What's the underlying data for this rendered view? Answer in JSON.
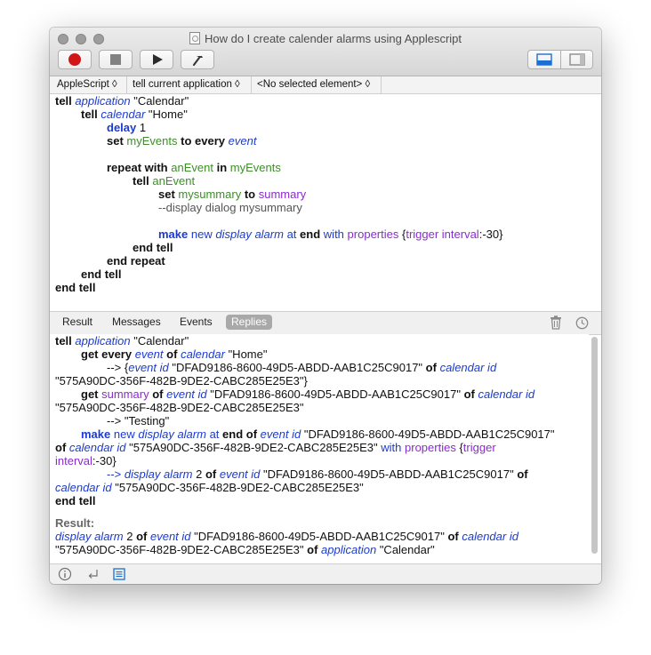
{
  "window": {
    "title": "How do I create calender alarms using Applescript"
  },
  "toolbar": {
    "record_icon": "record-dot",
    "stop_icon": "stop-square",
    "run_icon": "play-triangle",
    "compile_icon": "hammer"
  },
  "navbar": {
    "language": "AppleScript ◊",
    "target": "tell current application ◊",
    "element": "<No selected element> ◊"
  },
  "editor": {
    "l1_kw": "tell",
    "l1_cls": "application",
    "l1_str": "\"Calendar\"",
    "l2_kw": "tell",
    "l2_cls": "calendar",
    "l2_str": "\"Home\"",
    "l3_cmd": "delay",
    "l3_num": "1",
    "l4_kw": "set",
    "l4_var": "myEvents",
    "l4_kw2": "to every",
    "l4_cls": "event",
    "l6_kw": "repeat with",
    "l6_var": "anEvent",
    "l6_kw2": "in",
    "l6_var2": "myEvents",
    "l7_kw": "tell",
    "l7_var": "anEvent",
    "l8_kw": "set",
    "l8_var": "mysummary",
    "l8_kw2": "to",
    "l8_prop": "summary",
    "l9_comment": "--display dialog mysummary",
    "l11_cmd": "make",
    "l11_enm": "new",
    "l11_cls": "display alarm",
    "l11_enm2": "at",
    "l11_kw": "end",
    "l11_enm3": "with",
    "l11_prop": "properties",
    "l11_brace": "{",
    "l11_prop2": "trigger interval",
    "l11_val": ":-30}",
    "l12_kw": "end tell",
    "l13_kw": "end repeat",
    "l14_kw": "end tell",
    "l15_kw": "end tell"
  },
  "tabs": {
    "result": "Result",
    "messages": "Messages",
    "events": "Events",
    "replies": "Replies"
  },
  "result": {
    "r1_kw": "tell",
    "r1_cls": "application",
    "r1_str": "\"Calendar\"",
    "r2_kw": "get every",
    "r2_cls": "event",
    "r2_kw2": "of",
    "r2_cls2": "calendar",
    "r2_str": "\"Home\"",
    "r3_arrow": "--> {",
    "r3_cls": "event id",
    "r3_str": "\"DFAD9186-8600-49D5-ABDD-AAB1C25C9017\"",
    "r3_kw": "of",
    "r3_cls2": "calendar id",
    "r4_str": "\"575A90DC-356F-482B-9DE2-CABC285E25E3\"}",
    "r5_kw": "get",
    "r5_prop": "summary",
    "r5_kw2": "of",
    "r5_cls": "event id",
    "r5_str": "\"DFAD9186-8600-49D5-ABDD-AAB1C25C9017\"",
    "r5_kw3": "of",
    "r5_cls2": "calendar id",
    "r6_str": "\"575A90DC-356F-482B-9DE2-CABC285E25E3\"",
    "r7_arrow": "--> \"Testing\"",
    "r8_cmd": "make",
    "r8_enm": "new",
    "r8_cls": "display alarm",
    "r8_enm2": "at",
    "r8_kw": "end of",
    "r8_cls2": "event id",
    "r8_str": "\"DFAD9186-8600-49D5-ABDD-AAB1C25C9017\"",
    "r9_kw": "of",
    "r9_cls": "calendar id",
    "r9_str": "\"575A90DC-356F-482B-9DE2-CABC285E25E3\"",
    "r9_enm": "with",
    "r9_prop": "properties",
    "r9_brace": "{",
    "r9_prop2": "trigger",
    "r10_prop": "interval",
    "r10_val": ":-30}",
    "r11_arrow": "-->",
    "r11_cls": "display alarm",
    "r11_num": "2",
    "r11_kw": "of",
    "r11_cls2": "event id",
    "r11_str": "\"DFAD9186-8600-49D5-ABDD-AAB1C25C9017\"",
    "r11_kw2": "of",
    "r12_cls": "calendar id",
    "r12_str": "\"575A90DC-356F-482B-9DE2-CABC285E25E3\"",
    "r13_kw": "end tell",
    "result_label": "Result:",
    "res1_cls": "display alarm",
    "res1_num": "2",
    "res1_kw": "of",
    "res1_cls2": "event id",
    "res1_str": "\"DFAD9186-8600-49D5-ABDD-AAB1C25C9017\"",
    "res1_kw2": "of",
    "res1_cls3": "calendar id",
    "res2_str": "\"575A90DC-356F-482B-9DE2-CABC285E25E3\"",
    "res2_kw": "of",
    "res2_cls": "application",
    "res2_str2": "\"Calendar\""
  }
}
